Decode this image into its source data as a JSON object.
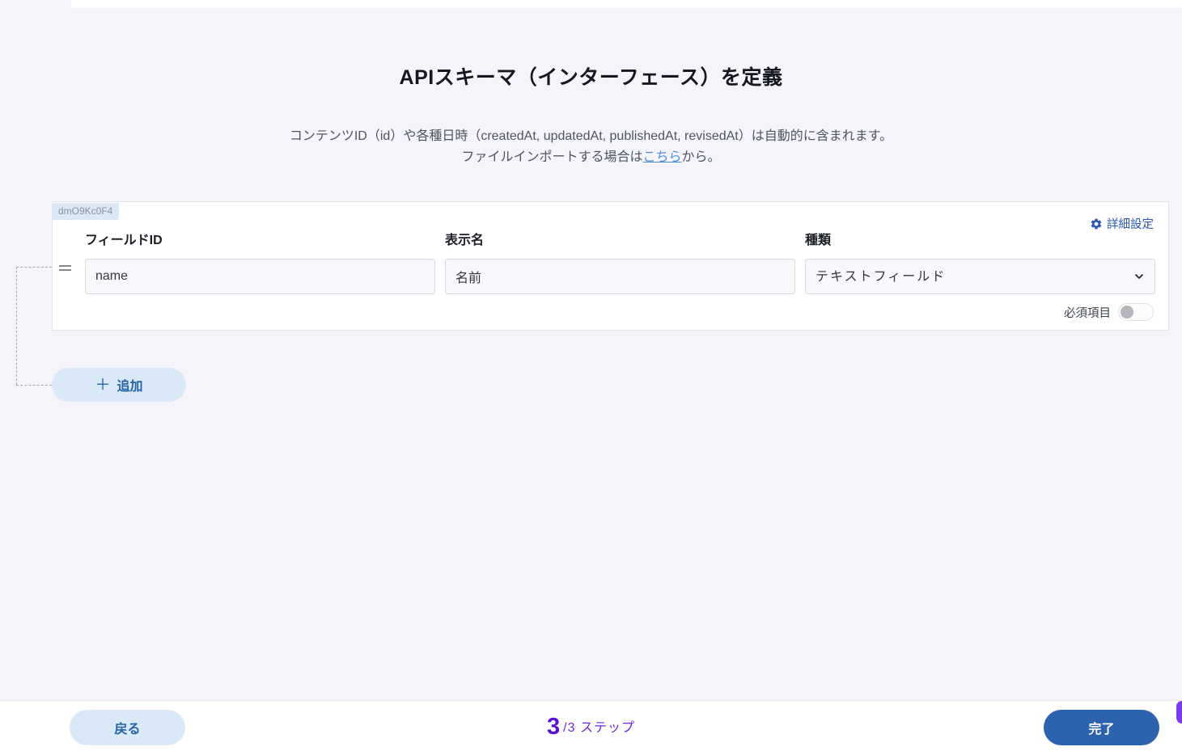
{
  "header": {
    "title": "APIスキーマ（インターフェース）を定義",
    "subtitle_line1": "コンテンツID（id）や各種日時（createdAt, updatedAt, publishedAt, revisedAt）は自動的に含まれます。",
    "subtitle_line2_prefix": "ファイルインポートする場合は",
    "subtitle_link": "こちら",
    "subtitle_line2_suffix": "から。"
  },
  "field_card": {
    "badge": "dmO9Kc0F4",
    "advanced_settings_label": "詳細設定",
    "fields": {
      "field_id": {
        "label": "フィールドID",
        "value": "name"
      },
      "display_name": {
        "label": "表示名",
        "value": "名前"
      },
      "kind": {
        "label": "種類",
        "value": "テキストフィールド"
      }
    },
    "required_label": "必須項目",
    "required_enabled": false
  },
  "add_button": {
    "label": "追加",
    "plus": "＋"
  },
  "footer": {
    "back_label": "戻る",
    "step_current": "3",
    "step_suffix": "/3 ステップ",
    "done_label": "完了"
  },
  "colors": {
    "page_background": "#f5f4fa",
    "primary_button_blue": "#2d62ae",
    "light_button_blue": "#d9e9f7",
    "button_text_blue": "#2563a8",
    "link_blue": "#2a56b5",
    "subtitle_link_blue": "#4a90d9",
    "step_purple": "#5b0fd1",
    "badge_background": "#dbe9f6"
  }
}
